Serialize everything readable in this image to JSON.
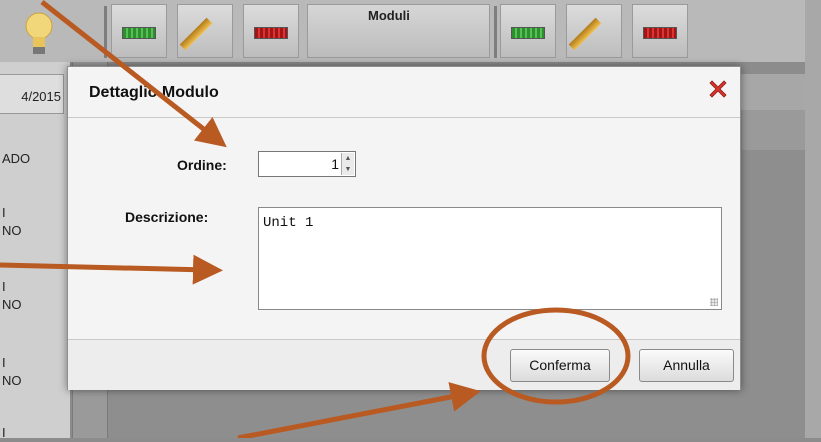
{
  "toolbar": {
    "title": "Moduli",
    "icons": [
      "lightbulb-icon",
      "green-bar-icon",
      "pencil-icon",
      "red-bar-icon"
    ]
  },
  "background": {
    "date": "4/2015",
    "left_labels": [
      "ADO",
      "I",
      "NO",
      "I",
      "NO",
      "I",
      "NO",
      "I"
    ]
  },
  "dialog": {
    "title": "Dettaglio Modulo",
    "close_icon": "close-x-icon",
    "ordine_label": "Ordine:",
    "ordine_value": "1",
    "descrizione_label": "Descrizione:",
    "descrizione_value": "Unit 1",
    "confirm_label": "Conferma",
    "cancel_label": "Annulla"
  },
  "colors": {
    "arrow": "#b85a22",
    "close": "#d9342b"
  }
}
